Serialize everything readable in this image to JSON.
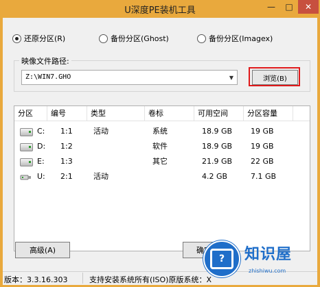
{
  "window": {
    "title": "U深度PE装机工具",
    "min": "—",
    "max": "□",
    "close": "✕"
  },
  "radios": [
    {
      "label": "还原分区(R)",
      "selected": true
    },
    {
      "label": "备份分区(Ghost)",
      "selected": false
    },
    {
      "label": "备份分区(Imagex)",
      "selected": false
    }
  ],
  "image": {
    "group_label": "映像文件路径:",
    "path": "Z:\\WIN7.GHO",
    "browse": "浏览(B)"
  },
  "table": {
    "columns": [
      "分区",
      "编号",
      "类型",
      "卷标",
      "可用空间",
      "分区容量"
    ],
    "rows": [
      {
        "partition": "C:",
        "number": "1:1",
        "type": "活动",
        "label": "系统",
        "free": "18.9 GB",
        "size": "19 GB",
        "icon": "disk-icon"
      },
      {
        "partition": "D:",
        "number": "1:2",
        "type": "",
        "label": "软件",
        "free": "18.9 GB",
        "size": "19 GB",
        "icon": "disk-icon"
      },
      {
        "partition": "E:",
        "number": "1:3",
        "type": "",
        "label": "其它",
        "free": "21.9 GB",
        "size": "22 GB",
        "icon": "disk-icon"
      },
      {
        "partition": "U:",
        "number": "2:1",
        "type": "活动",
        "label": "",
        "free": "4.2 GB",
        "size": "7.1 GB",
        "icon": "usb-icon"
      }
    ]
  },
  "buttons": {
    "advanced": "高级(A)",
    "ok": "确定"
  },
  "status": {
    "version": "版本：3.3.16.303",
    "support": "支持安装系统所有(ISO)原版系统：X"
  },
  "watermark": {
    "text": "知识屋",
    "url": "zhishiwu.com"
  },
  "colors": {
    "titlebar": "#e9a93d",
    "close": "#c7503f",
    "highlight": "#e0191a"
  }
}
